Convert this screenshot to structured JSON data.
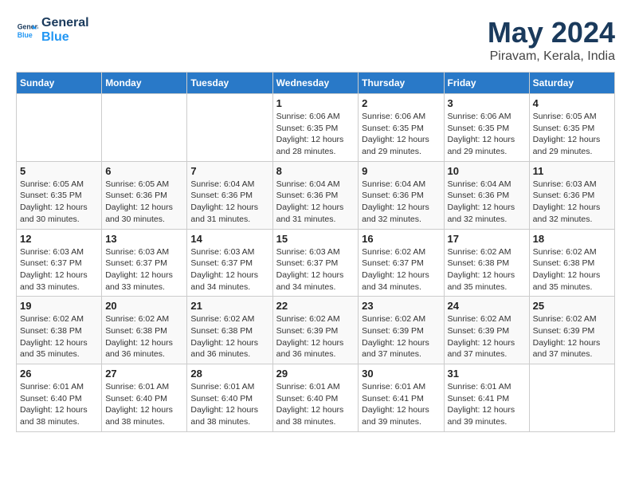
{
  "header": {
    "logo_line1": "General",
    "logo_line2": "Blue",
    "month": "May 2024",
    "location": "Piravam, Kerala, India"
  },
  "weekdays": [
    "Sunday",
    "Monday",
    "Tuesday",
    "Wednesday",
    "Thursday",
    "Friday",
    "Saturday"
  ],
  "weeks": [
    [
      {
        "day": "",
        "info": ""
      },
      {
        "day": "",
        "info": ""
      },
      {
        "day": "",
        "info": ""
      },
      {
        "day": "1",
        "info": "Sunrise: 6:06 AM\nSunset: 6:35 PM\nDaylight: 12 hours\nand 28 minutes."
      },
      {
        "day": "2",
        "info": "Sunrise: 6:06 AM\nSunset: 6:35 PM\nDaylight: 12 hours\nand 29 minutes."
      },
      {
        "day": "3",
        "info": "Sunrise: 6:06 AM\nSunset: 6:35 PM\nDaylight: 12 hours\nand 29 minutes."
      },
      {
        "day": "4",
        "info": "Sunrise: 6:05 AM\nSunset: 6:35 PM\nDaylight: 12 hours\nand 29 minutes."
      }
    ],
    [
      {
        "day": "5",
        "info": "Sunrise: 6:05 AM\nSunset: 6:35 PM\nDaylight: 12 hours\nand 30 minutes."
      },
      {
        "day": "6",
        "info": "Sunrise: 6:05 AM\nSunset: 6:36 PM\nDaylight: 12 hours\nand 30 minutes."
      },
      {
        "day": "7",
        "info": "Sunrise: 6:04 AM\nSunset: 6:36 PM\nDaylight: 12 hours\nand 31 minutes."
      },
      {
        "day": "8",
        "info": "Sunrise: 6:04 AM\nSunset: 6:36 PM\nDaylight: 12 hours\nand 31 minutes."
      },
      {
        "day": "9",
        "info": "Sunrise: 6:04 AM\nSunset: 6:36 PM\nDaylight: 12 hours\nand 32 minutes."
      },
      {
        "day": "10",
        "info": "Sunrise: 6:04 AM\nSunset: 6:36 PM\nDaylight: 12 hours\nand 32 minutes."
      },
      {
        "day": "11",
        "info": "Sunrise: 6:03 AM\nSunset: 6:36 PM\nDaylight: 12 hours\nand 32 minutes."
      }
    ],
    [
      {
        "day": "12",
        "info": "Sunrise: 6:03 AM\nSunset: 6:37 PM\nDaylight: 12 hours\nand 33 minutes."
      },
      {
        "day": "13",
        "info": "Sunrise: 6:03 AM\nSunset: 6:37 PM\nDaylight: 12 hours\nand 33 minutes."
      },
      {
        "day": "14",
        "info": "Sunrise: 6:03 AM\nSunset: 6:37 PM\nDaylight: 12 hours\nand 34 minutes."
      },
      {
        "day": "15",
        "info": "Sunrise: 6:03 AM\nSunset: 6:37 PM\nDaylight: 12 hours\nand 34 minutes."
      },
      {
        "day": "16",
        "info": "Sunrise: 6:02 AM\nSunset: 6:37 PM\nDaylight: 12 hours\nand 34 minutes."
      },
      {
        "day": "17",
        "info": "Sunrise: 6:02 AM\nSunset: 6:38 PM\nDaylight: 12 hours\nand 35 minutes."
      },
      {
        "day": "18",
        "info": "Sunrise: 6:02 AM\nSunset: 6:38 PM\nDaylight: 12 hours\nand 35 minutes."
      }
    ],
    [
      {
        "day": "19",
        "info": "Sunrise: 6:02 AM\nSunset: 6:38 PM\nDaylight: 12 hours\nand 35 minutes."
      },
      {
        "day": "20",
        "info": "Sunrise: 6:02 AM\nSunset: 6:38 PM\nDaylight: 12 hours\nand 36 minutes."
      },
      {
        "day": "21",
        "info": "Sunrise: 6:02 AM\nSunset: 6:38 PM\nDaylight: 12 hours\nand 36 minutes."
      },
      {
        "day": "22",
        "info": "Sunrise: 6:02 AM\nSunset: 6:39 PM\nDaylight: 12 hours\nand 36 minutes."
      },
      {
        "day": "23",
        "info": "Sunrise: 6:02 AM\nSunset: 6:39 PM\nDaylight: 12 hours\nand 37 minutes."
      },
      {
        "day": "24",
        "info": "Sunrise: 6:02 AM\nSunset: 6:39 PM\nDaylight: 12 hours\nand 37 minutes."
      },
      {
        "day": "25",
        "info": "Sunrise: 6:02 AM\nSunset: 6:39 PM\nDaylight: 12 hours\nand 37 minutes."
      }
    ],
    [
      {
        "day": "26",
        "info": "Sunrise: 6:01 AM\nSunset: 6:40 PM\nDaylight: 12 hours\nand 38 minutes."
      },
      {
        "day": "27",
        "info": "Sunrise: 6:01 AM\nSunset: 6:40 PM\nDaylight: 12 hours\nand 38 minutes."
      },
      {
        "day": "28",
        "info": "Sunrise: 6:01 AM\nSunset: 6:40 PM\nDaylight: 12 hours\nand 38 minutes."
      },
      {
        "day": "29",
        "info": "Sunrise: 6:01 AM\nSunset: 6:40 PM\nDaylight: 12 hours\nand 38 minutes."
      },
      {
        "day": "30",
        "info": "Sunrise: 6:01 AM\nSunset: 6:41 PM\nDaylight: 12 hours\nand 39 minutes."
      },
      {
        "day": "31",
        "info": "Sunrise: 6:01 AM\nSunset: 6:41 PM\nDaylight: 12 hours\nand 39 minutes."
      },
      {
        "day": "",
        "info": ""
      }
    ]
  ]
}
